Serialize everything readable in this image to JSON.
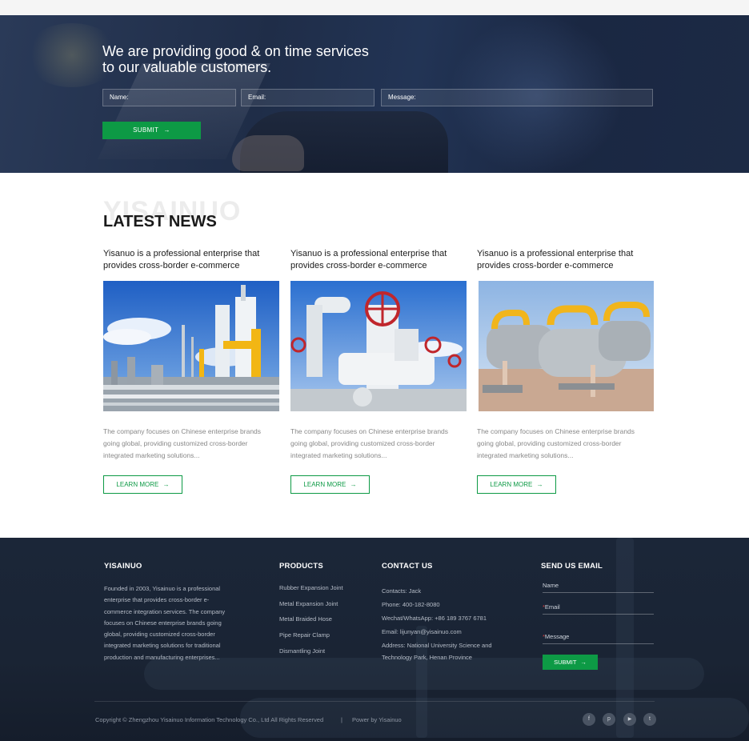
{
  "hero": {
    "title_line1": "We are providing good & on time services",
    "title_line2": "to our valuable customers.",
    "name_placeholder": "Name:",
    "email_placeholder": "Email:",
    "message_placeholder": "Message:",
    "submit_label": "SUBMIT",
    "submit_icon": "→"
  },
  "news": {
    "watermark": "YISAINUO",
    "heading": "LATEST NEWS",
    "cards": [
      {
        "title": "Yisanuo is a professional enterprise that provides cross-border e-commerce",
        "excerpt": "The company focuses on Chinese enterprise brands going global, providing customized cross-border integrated marketing solutions...",
        "button": "LEARN MORE",
        "icon": "→"
      },
      {
        "title": "Yisanuo is a professional enterprise that provides cross-border e-commerce",
        "excerpt": "The company focuses on Chinese enterprise brands going global, providing customized cross-border integrated marketing solutions...",
        "button": "LEARN MORE",
        "icon": "→"
      },
      {
        "title": "Yisanuo is a professional enterprise that provides cross-border e-commerce",
        "excerpt": "The company focuses on Chinese enterprise brands going global, providing customized cross-border integrated marketing solutions...",
        "button": "LEARN MORE",
        "icon": "→"
      }
    ]
  },
  "footer": {
    "about_heading": "YISAINUO",
    "about_text": "Founded in 2003, Yisainuo is a professional enterprise that provides cross-border e-commerce integration services. The company focuses on Chinese enterprise brands going global, providing customized cross-border integrated marketing solutions for traditional production and manufacturing enterprises...",
    "products_heading": "PRODUCTS",
    "products": [
      "Rubber Expansion Joint",
      "Metal Expansion Joint",
      "Metal Braided Hose",
      "Pipe Repair Clamp",
      "Dismantling Joint"
    ],
    "contact_heading": "CONTACT US",
    "contact_person": "Contacts:  Jack",
    "phone": "Phone: 400-182-8080",
    "wechat": "Wechat/WhatsApp: +86 189 3767 6781",
    "email": "Email: lijunyan@yisainuo.com",
    "address": "Address: National University Science and Technology Park, Henan Province",
    "send_heading": "SEND US EMAIL",
    "name_label": "Name",
    "email_label": "Email",
    "message_label": "Message",
    "required_mark": "*",
    "submit_label": "SUBMIT",
    "submit_icon": "→",
    "copyright": "Copyright © Zhengzhou Yisainuo Information Technology Co., Ltd  All Rights Reserved",
    "separator": "|",
    "powered": "Power by Yisainuo",
    "social": [
      {
        "icon": "facebook-icon",
        "glyph": "f"
      },
      {
        "icon": "pinterest-icon",
        "glyph": "p"
      },
      {
        "icon": "youtube-icon",
        "glyph": "▶"
      },
      {
        "icon": "twitter-icon",
        "glyph": "t"
      }
    ],
    "accent_color": "#0d9a45"
  }
}
